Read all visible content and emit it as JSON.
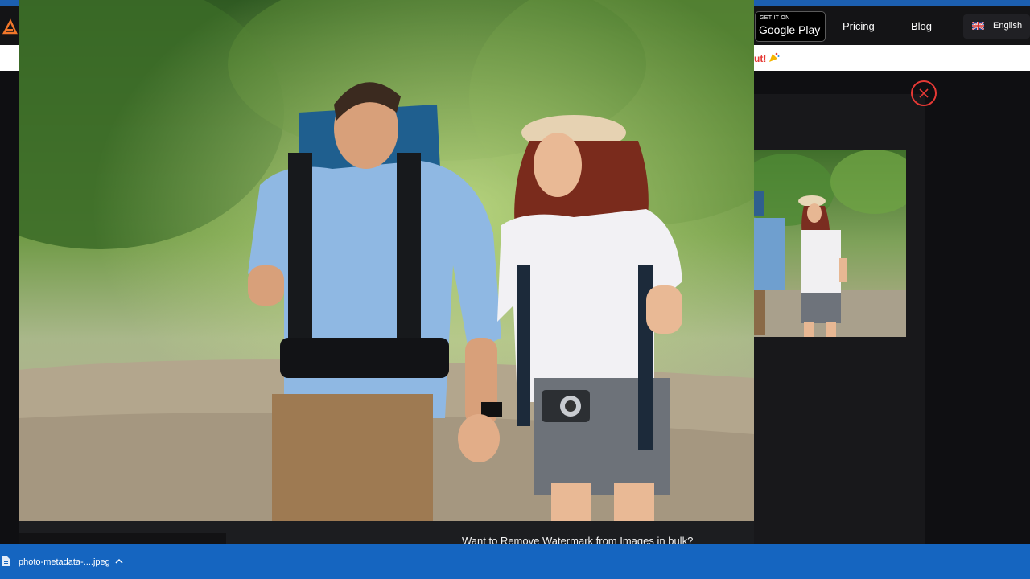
{
  "header": {
    "google_play_small": "GET IT ON",
    "google_play_big": "Google Play",
    "nav": [
      "Pricing",
      "Blog"
    ],
    "language": "English"
  },
  "banner": {
    "text": "ut!"
  },
  "cta": {
    "text": "Want to Remove Watermark from Images in bulk?"
  },
  "download": {
    "filename": "photo-metadata-....jpeg"
  },
  "icons": {
    "logo": "logo-icon",
    "flag": "uk-flag-icon",
    "close": "close-icon",
    "file": "file-icon",
    "chevron": "chevron-up-icon",
    "emoji": "party-icon"
  },
  "colors": {
    "accent_blue": "#1c5fb0",
    "download_bar": "#1565c0",
    "close_red": "#e53935",
    "background": "#0f0f12"
  }
}
